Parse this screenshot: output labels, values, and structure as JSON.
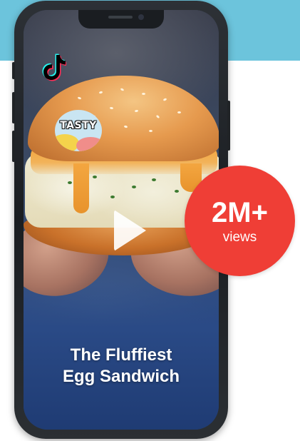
{
  "video": {
    "title_line1": "The Fluffiest",
    "title_line2": "Egg Sandwich",
    "brand_badge": "TASTY",
    "platform_icon": "tiktok-logo-icon",
    "play_icon": "play-icon"
  },
  "views_badge": {
    "count": "2M+",
    "label": "views"
  },
  "colors": {
    "teal_band": "#6cc4dc",
    "badge_red": "#ef3e36",
    "phone_frame": "#1a1d21",
    "text_white": "#ffffff"
  }
}
